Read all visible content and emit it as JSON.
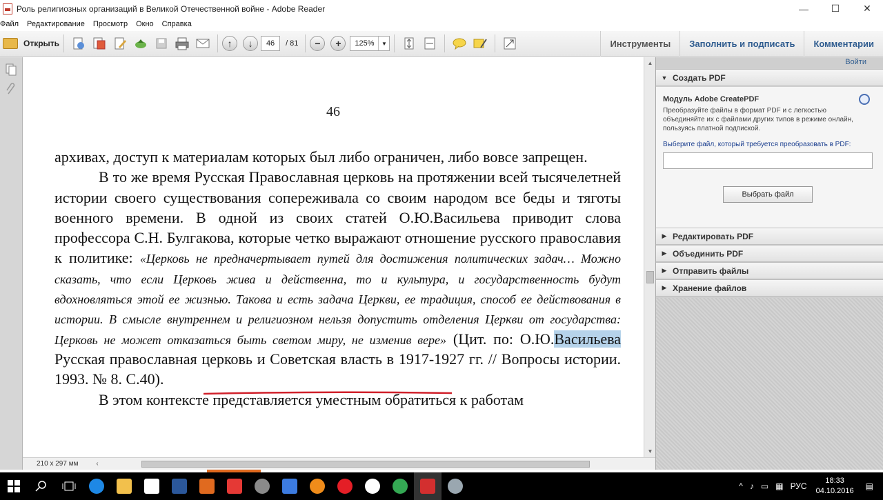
{
  "window": {
    "title": "Роль религиозных организаций в Великой Отечественной войне - Adobe Reader",
    "minimize": "—",
    "maximize": "☐",
    "close": "✕"
  },
  "menu": [
    "Файл",
    "Редактирование",
    "Просмотр",
    "Окно",
    "Справка"
  ],
  "toolbar": {
    "open_label": "Открыть",
    "page_current": "46",
    "page_total": "/ 81",
    "zoom": "125%",
    "tabs": [
      "Инструменты",
      "Заполнить и подписать",
      "Комментарии"
    ]
  },
  "document": {
    "page_number": "46",
    "paragraph1": "архивах, доступ к материалам которых был либо ограничен, либо вовсе запрещен.",
    "paragraph2_start": "В то же время Русская Православная церковь на протяжении всей тысячелетней истории своего существования сопереживала со своим народом все беды и тяготы военного времени. В одной из своих статей О.Ю.Васильева приводит слова профессора С.Н. Булгакова, которые четко выражают отношение русского православия к политике: ",
    "quote": "«Церковь не предначертывает путей для достижения политических задач… Можно сказать, что если Церковь жива и действенна, то и культура, и государственность будут вдохновляться этой ее жизнью. Такова и есть задача Церкви, ее традиция, способ ее действования в истории. В смысле внутреннем и религиозном нельзя допустить отделения Церкви от государства: Церковь не может отказаться быть светом миру, не изменив вере»",
    "cite_before": " (Цит. по: О.Ю.",
    "cite_highlight": "Васильева",
    "cite_after": " Русская православная церковь и Советская власть в 1917-1927 гг. // Вопросы истории. 1993. № 8. С.40).",
    "paragraph3": "В этом контексте представляется уместным обратиться к работам",
    "page_size": "210 x 297 мм"
  },
  "right_panel": {
    "login": "Войти",
    "create_pdf": "Создать PDF",
    "module_title": "Модуль Adobe CreatePDF",
    "module_desc": "Преобразуйте файлы в формат PDF и с легкостью объединяйте их с файлами других типов в режиме онлайн, пользуясь платной подпиской.",
    "choose_label": "Выберите файл, который требуется преобразовать в PDF:",
    "choose_button": "Выбрать файл",
    "sections": [
      "Редактировать PDF",
      "Объединить PDF",
      "Отправить файлы",
      "Хранение файлов"
    ]
  },
  "taskbar": {
    "language": "РУС",
    "time": "18:33",
    "date": "04.10.2016"
  },
  "colors": {
    "highlight": "#b6d3ea",
    "underline": "#d0202a",
    "accent_tab": "#2f5c8f"
  }
}
